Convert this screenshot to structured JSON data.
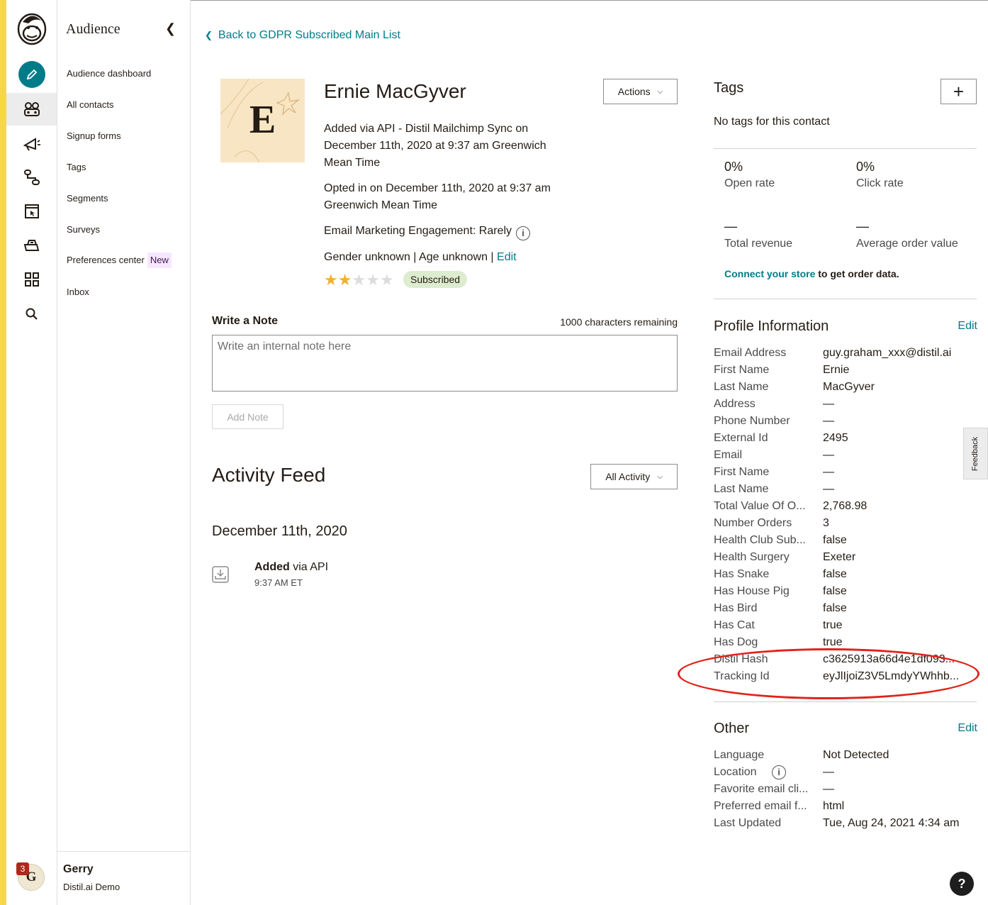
{
  "nav_rail": {
    "icons": [
      "mailchimp-freddie-logo",
      "create-pencil-icon",
      "audience-icon",
      "campaigns-megaphone-icon",
      "automations-icon",
      "website-icon",
      "content-studio-icon",
      "integrations-grid-icon",
      "search-icon"
    ],
    "active": "audience-icon",
    "notifications": "3",
    "avatar_letter": "G"
  },
  "sidenav": {
    "title": "Audience",
    "items": [
      {
        "label": "Audience dashboard"
      },
      {
        "label": "All contacts"
      },
      {
        "label": "Signup forms"
      },
      {
        "label": "Tags"
      },
      {
        "label": "Segments"
      },
      {
        "label": "Surveys"
      },
      {
        "label": "Preferences center",
        "badge": "New"
      },
      {
        "label": "Inbox"
      }
    ],
    "user_name": "Gerry",
    "user_org": "Distil.ai Demo"
  },
  "back_link": "Back to GDPR Subscribed Main List",
  "contact": {
    "initial": "E",
    "name": "Ernie MacGyver",
    "actions_label": "Actions",
    "added_line1": "Added via API - Distil Mailchimp Sync on",
    "added_line2": "December 11th, 2020 at 9:37 am Greenwich",
    "added_line3": "Mean Time",
    "opted_line1": "Opted in on December 11th, 2020 at 9:37 am",
    "opted_line2": "Greenwich Mean Time",
    "engagement": "Email Marketing Engagement: Rarely",
    "demographics": "Gender unknown | Age unknown |",
    "demographics_edit": "Edit",
    "rating": 2,
    "rating_max": 5,
    "status": "Subscribed"
  },
  "note": {
    "title": "Write a Note",
    "remaining": "1000 characters remaining",
    "placeholder": "Write an internal note here",
    "button": "Add Note"
  },
  "activity": {
    "title": "Activity Feed",
    "filter": "All Activity",
    "date": "December 11th, 2020",
    "events": [
      {
        "action": "Added",
        "detail": " via API",
        "time": "9:37 AM ET"
      }
    ]
  },
  "tags": {
    "title": "Tags",
    "add_label": "+",
    "empty": "No tags for this contact"
  },
  "stats": {
    "open_rate": "0%",
    "open_rate_label": "Open rate",
    "click_rate": "0%",
    "click_rate_label": "Click rate",
    "total_revenue": "—",
    "total_revenue_label": "Total revenue",
    "avg_order": "—",
    "avg_order_label": "Average order value",
    "connect_link": "Connect your store",
    "connect_rest": " to get order data."
  },
  "profile": {
    "title": "Profile Information",
    "edit": "Edit",
    "rows": [
      {
        "key": "Email Address",
        "value": "guy.graham_xxx@distil.ai",
        "link": true
      },
      {
        "key": "First Name",
        "value": "Ernie"
      },
      {
        "key": "Last Name",
        "value": "MacGyver"
      },
      {
        "key": "Address",
        "value": "—"
      },
      {
        "key": "Phone Number",
        "value": "—"
      },
      {
        "key": "External Id",
        "value": "2495"
      },
      {
        "key": "Email",
        "value": "—"
      },
      {
        "key": "First Name",
        "value": "—"
      },
      {
        "key": "Last Name",
        "value": "—"
      },
      {
        "key": "Total Value Of O...",
        "value": "2,768.98"
      },
      {
        "key": "Number Orders",
        "value": "3"
      },
      {
        "key": "Health Club Sub...",
        "value": "false"
      },
      {
        "key": "Health Surgery",
        "value": "Exeter"
      },
      {
        "key": "Has Snake",
        "value": "false"
      },
      {
        "key": "Has House Pig",
        "value": "false"
      },
      {
        "key": "Has Bird",
        "value": "false"
      },
      {
        "key": "Has Cat",
        "value": "true"
      },
      {
        "key": "Has Dog",
        "value": "true"
      },
      {
        "key": "Distil Hash",
        "value": "c3625913a66d4e1df093..."
      },
      {
        "key": "Tracking Id",
        "value": "eyJlIjoiZ3V5LmdyYWhhb..."
      }
    ]
  },
  "other": {
    "title": "Other",
    "edit": "Edit",
    "rows": [
      {
        "key": "Language",
        "value": "Not Detected"
      },
      {
        "key": "Location",
        "value": "—",
        "info": true
      },
      {
        "key": "Favorite email cli...",
        "value": "—"
      },
      {
        "key": "Preferred email f...",
        "value": "html"
      },
      {
        "key": "Last Updated",
        "value": "Tue, Aug 24, 2021 4:34 am"
      }
    ]
  },
  "feedback_tab": "Feedback",
  "help": "?",
  "colors": {
    "accent": "#007c89",
    "annotation": "#e0231a",
    "star": "#f2b02d",
    "subscribed_bg": "#ddeccf"
  }
}
